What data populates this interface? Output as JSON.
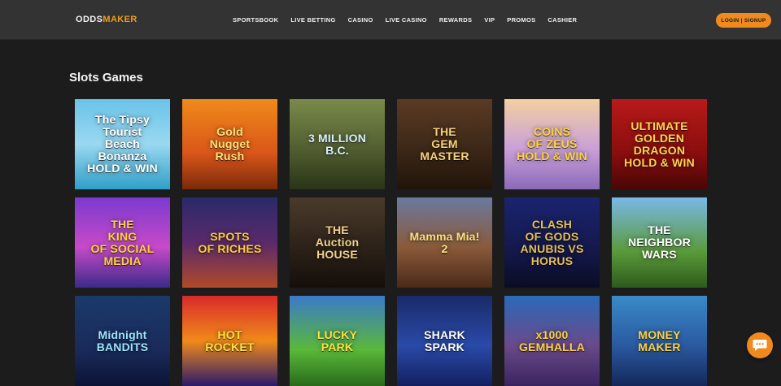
{
  "header": {
    "logo_part1": "ODDS",
    "logo_part2": "MAKER",
    "nav": [
      "SPORTSBOOK",
      "LIVE BETTING",
      "CASINO",
      "LIVE CASINO",
      "REWARDS",
      "VIP",
      "PROMOS",
      "CASHIER"
    ],
    "login_label": "LOGIN | SIGNUP"
  },
  "main": {
    "section_title": "Slots Games",
    "games": [
      {
        "title": "The Tipsy Tourist\nBeach Bonanza\nHOLD & WIN",
        "bg": "linear-gradient(180deg,#6bc3e8 0%,#9ad8f0 50%,#2f9fc9 100%)",
        "color": "#ffffff"
      },
      {
        "title": "Gold\nNugget\nRush",
        "bg": "linear-gradient(180deg,#f08a1a 0%,#d9561a 60%,#7a2a0a 100%)",
        "color": "#ffe27a"
      },
      {
        "title": "3 MILLION\nB.C.",
        "bg": "linear-gradient(180deg,#7a8a4a 0%,#4e5a2e 60%,#2a3418 100%)",
        "color": "#d8f0ff"
      },
      {
        "title": "THE\nGEM\nMASTER",
        "bg": "linear-gradient(180deg,#5a3a24 0%,#3a2616 60%,#20140a 100%)",
        "color": "#f6d27a"
      },
      {
        "title": "COINS\nOF ZEUS\nHOLD & WIN",
        "bg": "linear-gradient(180deg,#f2d0a0 0%,#caa0d8 55%,#8a6ab8 100%)",
        "color": "#ffd23a"
      },
      {
        "title": "ULTIMATE\nGOLDEN\nDRAGON\nHOLD & WIN",
        "bg": "linear-gradient(180deg,#b81a1a 0%,#8a0e0e 60%,#4a0606 100%)",
        "color": "#ffd54a"
      },
      {
        "title": "THE\nKING\nOF SOCIAL\nMEDIA",
        "bg": "linear-gradient(180deg,#7a3ad0 0%,#c84ac8 55%,#3a2a8a 100%)",
        "color": "#ffd23a"
      },
      {
        "title": "SPOTS\nOF RICHES",
        "bg": "linear-gradient(180deg,#2a2a6a 0%,#5a2a6a 50%,#b04a2a 100%)",
        "color": "#ffcf3a"
      },
      {
        "title": "THE\nAuction\nHOUSE",
        "bg": "linear-gradient(180deg,#4a3a2a 0%,#2a2018 60%,#140e0a 100%)",
        "color": "#f3d28a"
      },
      {
        "title": "Mamma Mia!\n2",
        "bg": "linear-gradient(180deg,#6a7aa0 0%,#8a5a3a 55%,#4a2a18 100%)",
        "color": "#ffe27a"
      },
      {
        "title": "CLASH\nOF GODS\nANUBIS VS HORUS",
        "bg": "linear-gradient(180deg,#1a2470 0%,#14184a 60%,#0a0c24 100%)",
        "color": "#e6c050"
      },
      {
        "title": "THE\nNEIGHBOR\nWARS",
        "bg": "linear-gradient(180deg,#7ab8e8 0%,#5a9a3a 60%,#2e5a1c 100%)",
        "color": "#ffffff"
      },
      {
        "title": "Midnight\nBANDITS",
        "bg": "linear-gradient(180deg,#1a3a6a 0%,#1a2a5a 60%,#0c1436 100%)",
        "color": "#9ae6ff"
      },
      {
        "title": "HOT\nROCKET",
        "bg": "linear-gradient(180deg,#d82a2a 0%,#f08a1a 50%,#2a1a6a 100%)",
        "color": "#ffe23a"
      },
      {
        "title": "LUCKY\nPARK",
        "bg": "linear-gradient(180deg,#3a7ac8 0%,#5ab83a 60%,#2a6a1a 100%)",
        "color": "#ffe23a"
      },
      {
        "title": "SHARK\nSPARK",
        "bg": "linear-gradient(180deg,#1a2a6a 0%,#2a4aa8 55%,#122060 100%)",
        "color": "#ffffff"
      },
      {
        "title": "x1000\nGEMHALLA",
        "bg": "linear-gradient(180deg,#2a6ab8 0%,#6a4a8a 55%,#3a2460 100%)",
        "color": "#ffd23a"
      },
      {
        "title": "MONEY\nMAKER",
        "bg": "linear-gradient(180deg,#3a8ac8 0%,#2a5aa0 55%,#14285a 100%)",
        "color": "#ffd23a"
      }
    ]
  },
  "icons": {
    "chat": "chat-bubble-icon"
  },
  "colors": {
    "accent": "#f08a1c",
    "topbar": "#333333",
    "background": "#1c1c1c"
  }
}
